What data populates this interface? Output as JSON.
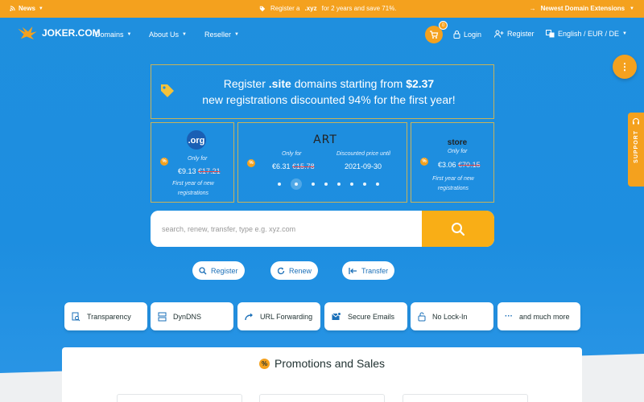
{
  "topbar": {
    "news": "News",
    "promo_pre": "Register a",
    "promo_tld": ".xyz",
    "promo_post": "for 2 years and save 71%.",
    "extensions": "Newest Domain Extensions"
  },
  "header": {
    "logo": "JOKER.COM",
    "nav": [
      "Domains",
      "About Us",
      "Reseller"
    ],
    "cart_count": "0",
    "login": "Login",
    "register": "Register",
    "locale": "English / EUR / DE"
  },
  "support": "SUPPORT",
  "hero": {
    "line1_pre": "Register",
    "line1_tld": ".site",
    "line1_mid": "domains starting from",
    "line1_price": "$2.37",
    "line2": "new registrations discounted 94% for the first year!"
  },
  "cards": {
    "left": {
      "logo": ".org",
      "only_for": "Only for",
      "price": "€9.13",
      "old": "€17.21",
      "note1": "First year of new",
      "note2": "registrations"
    },
    "mid": {
      "logo": "ART",
      "only_for": "Only for",
      "price": "€6.31",
      "old": "€15.78",
      "until_label": "Discounted price until",
      "until": "2021-09-30"
    },
    "right": {
      "logo": "store",
      "only_for": "Only for",
      "price": "€3.06",
      "old": "€70.15",
      "note1": "First year of new",
      "note2": "registrations"
    }
  },
  "search": {
    "placeholder": "search, renew, transfer, type e.g. xyz.com"
  },
  "actions": [
    "Register",
    "Renew",
    "Transfer"
  ],
  "features": [
    "Transparency",
    "DynDNS",
    "URL Forwarding",
    "Secure Emails",
    "No Lock-In",
    "and much more"
  ],
  "promotions": {
    "title": "Promotions and Sales"
  },
  "colors": {
    "accent": "#f4a11e",
    "brand": "#1f8fde"
  }
}
